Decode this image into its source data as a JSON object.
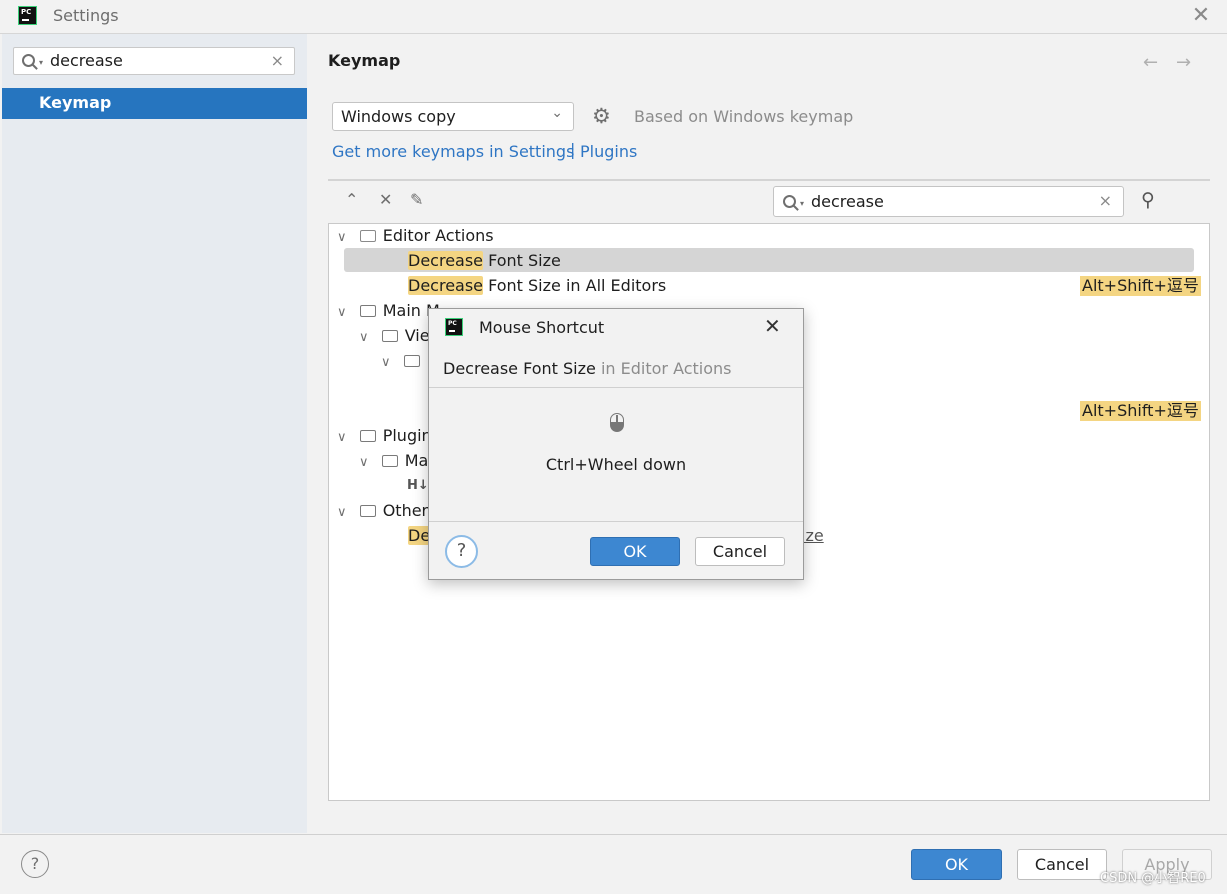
{
  "window": {
    "title": "Settings",
    "close_glyph": "✕"
  },
  "sidebar": {
    "search_value": "decrease",
    "items": [
      {
        "label": "Keymap",
        "selected": true
      }
    ]
  },
  "main": {
    "title": "Keymap",
    "nav_back": "←",
    "nav_forward": "→",
    "keymap_select": {
      "value": "Windows copy"
    },
    "based_on": "Based on Windows keymap",
    "more_keymaps_link": "Get more keymaps in Settings",
    "link_separator": "|",
    "plugins_link": "Plugins",
    "action_search_value": "decrease"
  },
  "tree": {
    "groups": [
      {
        "label": "Editor Actions",
        "children": [
          {
            "match": "Decrease",
            "rest": " Font Size",
            "selected": true
          },
          {
            "match": "Decrease",
            "rest": " Font Size in All Editors",
            "shortcut": "Alt+Shift+逗号"
          }
        ]
      },
      {
        "label": "Main M",
        "children": [
          {
            "label": "Vie"
          },
          {
            "label": ""
          }
        ],
        "shortcut": "Alt+Shift+逗号"
      },
      {
        "label": "Plugin",
        "children": [
          {
            "label": "Ma"
          },
          {
            "label": "H↓"
          }
        ]
      },
      {
        "label": "Other",
        "children": [
          {
            "match": "De",
            "trailing": "ize"
          }
        ]
      }
    ]
  },
  "dialog": {
    "title": "Mouse Shortcut",
    "close_glyph": "✕",
    "action_name": "Decrease Font Size",
    "action_context": " in Editor Actions",
    "shortcut": "Ctrl+Wheel down",
    "help_glyph": "?",
    "ok_label": "OK",
    "cancel_label": "Cancel"
  },
  "footer": {
    "help_glyph": "?",
    "ok_label": "OK",
    "cancel_label": "Cancel",
    "apply_label": "Apply"
  },
  "watermark": "CSDN @小智RE0",
  "colors": {
    "accent": "#2675bf",
    "highlight": "#f4d582",
    "link": "#2f76c4",
    "ok_button": "#3d87d1"
  },
  "icons": [
    "app-logo-icon",
    "search-icon",
    "clear-icon",
    "gear-icon",
    "expand-all-icon",
    "collapse-all-icon",
    "edit-shortcut-icon",
    "find-shortcut-icon",
    "folder-icon",
    "mouse-icon",
    "help-icon"
  ]
}
